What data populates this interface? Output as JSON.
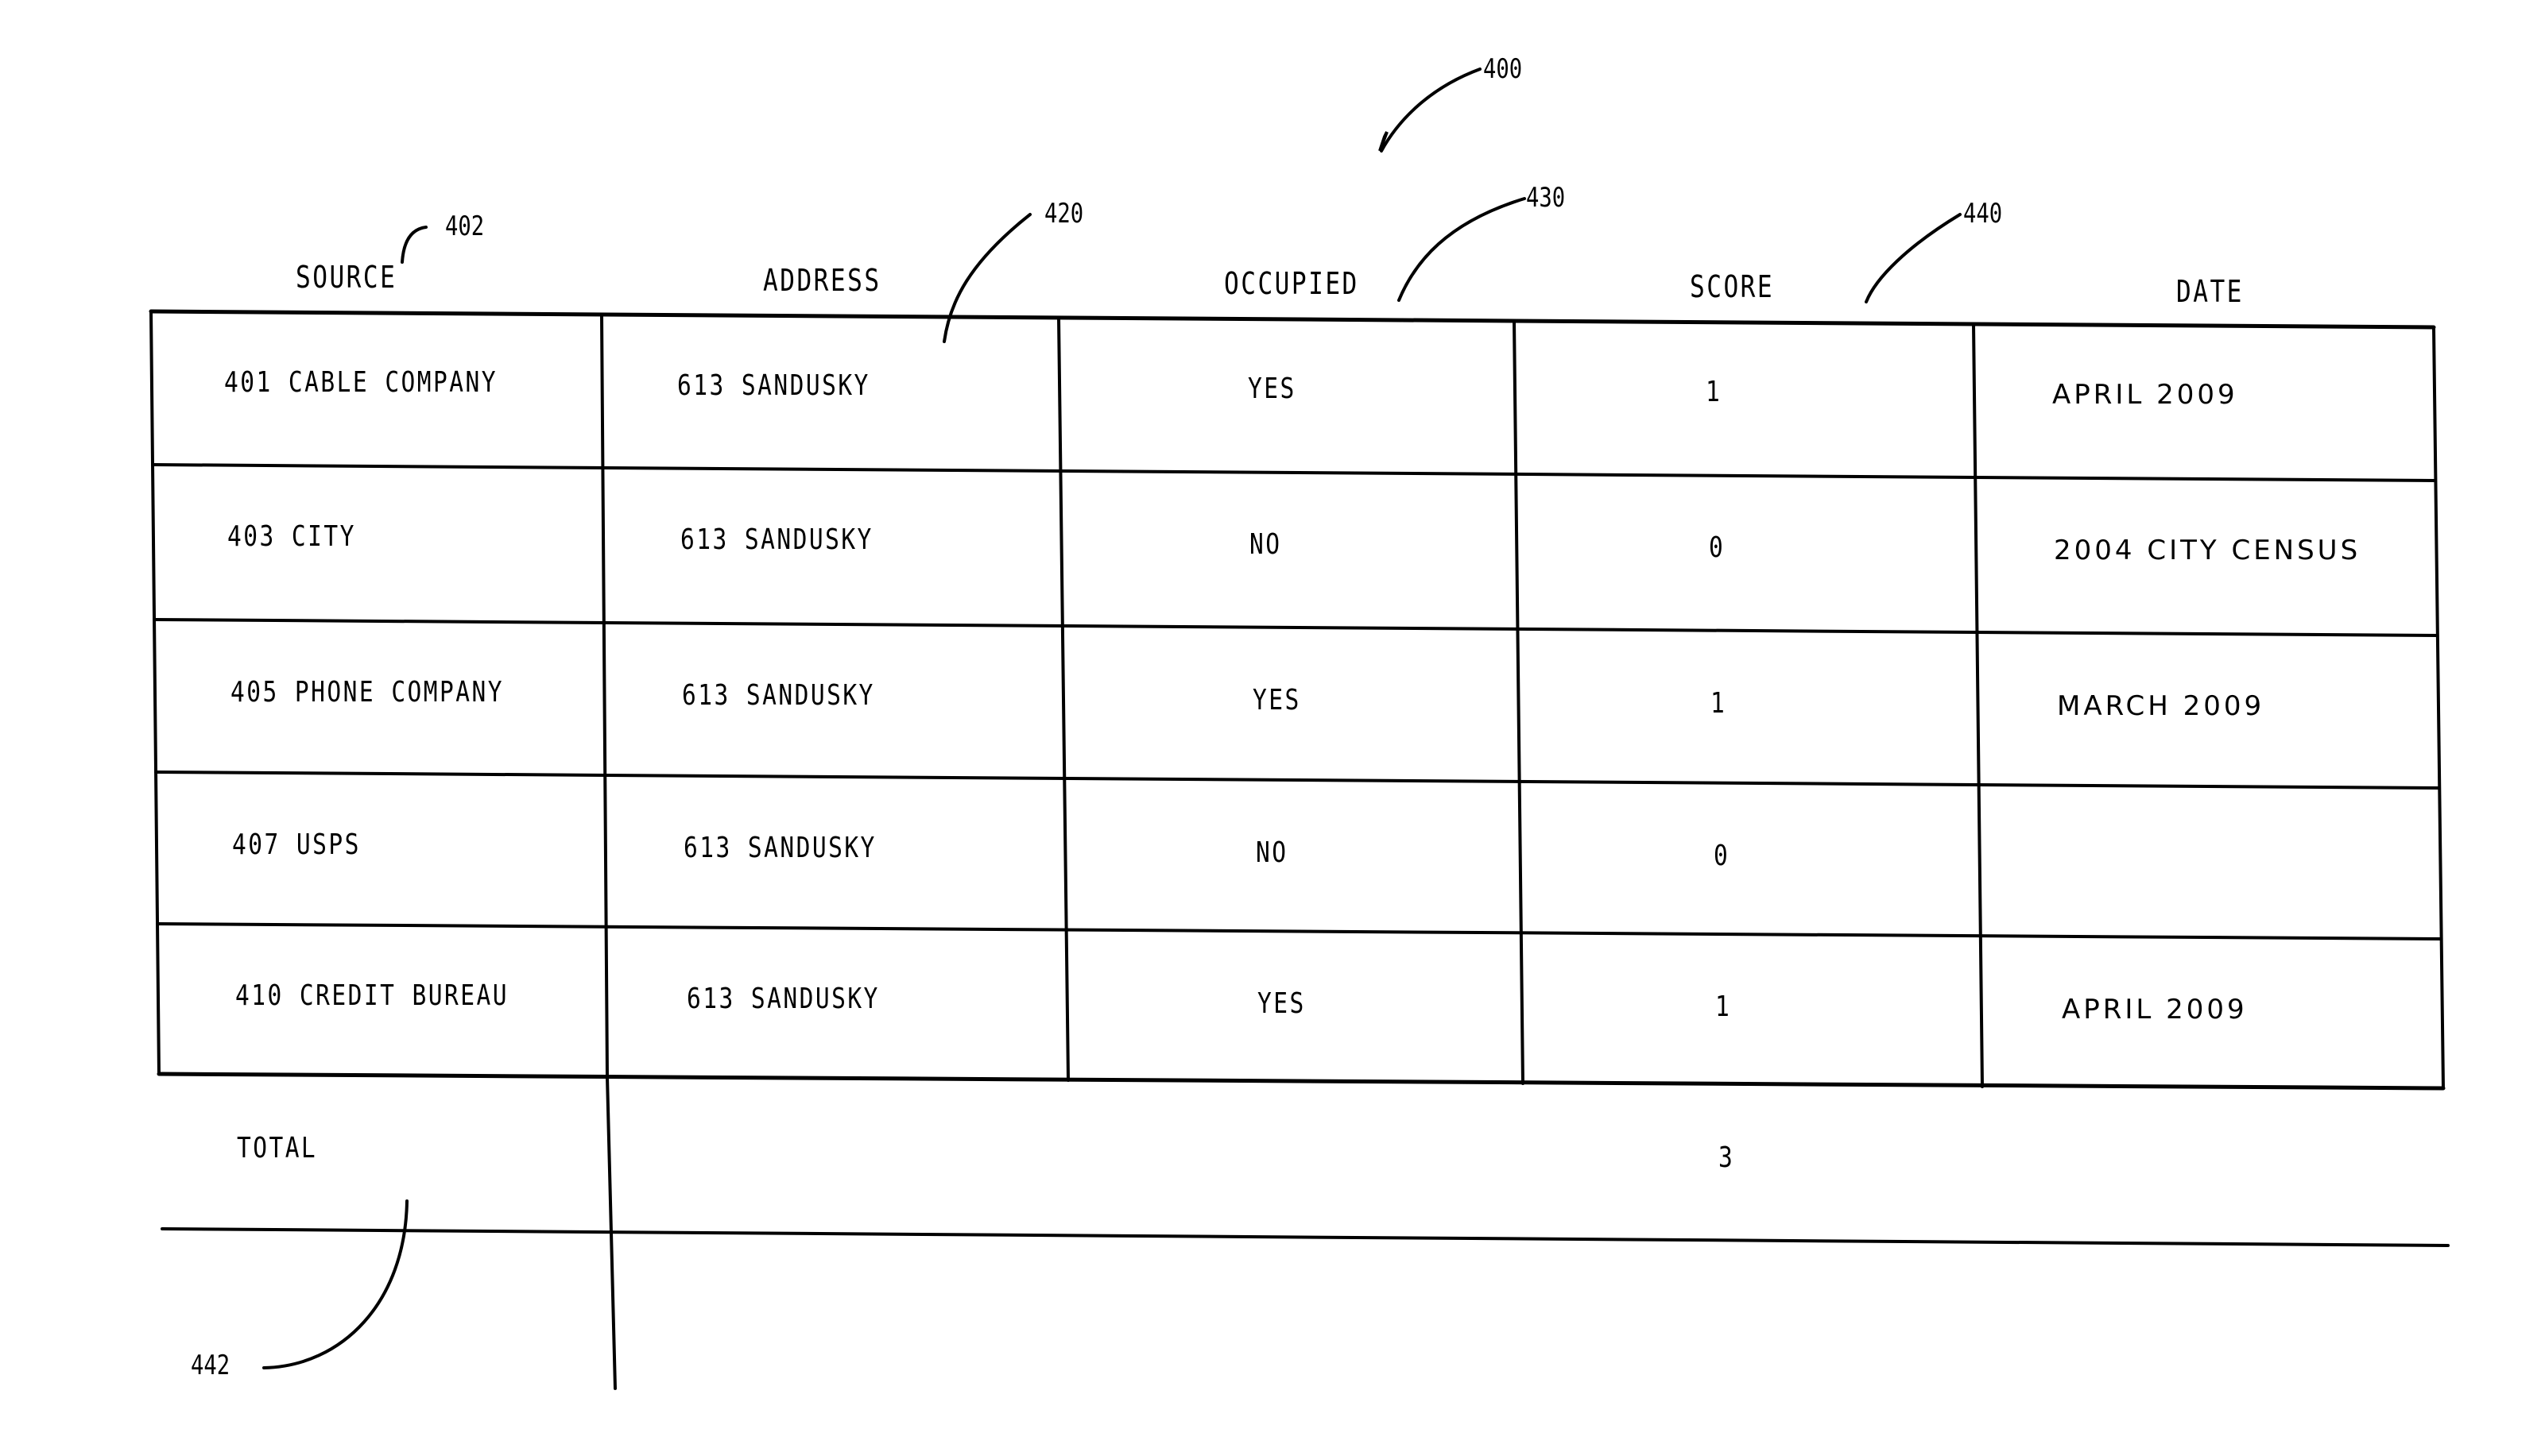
{
  "figure": {
    "reference_numerals": {
      "figure": "400",
      "source_column": "402",
      "address_column": "420",
      "occupied_column": "430",
      "score_column": "440",
      "total_row": "442"
    },
    "columns": [
      "SOURCE",
      "ADDRESS",
      "OCCUPIED",
      "SCORE",
      "DATE"
    ],
    "rows": [
      {
        "source": "401 CABLE COMPANY",
        "address": "613 SANDUSKY",
        "occupied": "YES",
        "score": "1",
        "date": "APRIL 2009"
      },
      {
        "source": "403 CITY",
        "address": "613 SANDUSKY",
        "occupied": "NO",
        "score": "0",
        "date": "2004 CITY CENSUS"
      },
      {
        "source": "405 PHONE COMPANY",
        "address": "613 SANDUSKY",
        "occupied": "YES",
        "score": "1",
        "date": "MARCH 2009"
      },
      {
        "source": "407 USPS",
        "address": "613 SANDUSKY",
        "occupied": "NO",
        "score": "0",
        "date": ""
      },
      {
        "source": "410 CREDIT BUREAU",
        "address": "613 SANDUSKY",
        "occupied": "YES",
        "score": "1",
        "date": "APRIL 2009"
      }
    ],
    "total": {
      "label": "TOTAL",
      "score": "3"
    }
  }
}
